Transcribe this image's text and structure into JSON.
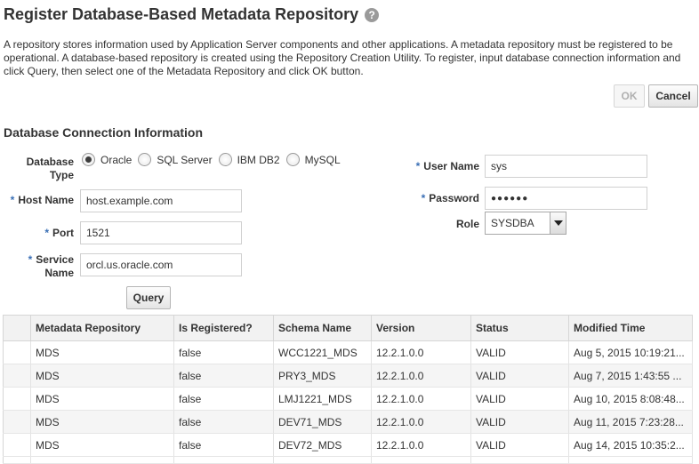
{
  "page": {
    "title": "Register Database-Based Metadata Repository",
    "description": "A repository stores information used by Application Server components and other applications. A metadata repository must be registered to be operational. A database-based repository is created using the Repository Creation Utility. To register, input database connection information and click Query, then select one of the Metadata Repository and click OK button."
  },
  "buttons": {
    "ok": "OK",
    "cancel": "Cancel",
    "query": "Query"
  },
  "section": {
    "title": "Database Connection Information"
  },
  "form": {
    "db_type_label_1": "Database",
    "db_type_label_2": "Type",
    "db_types": [
      "Oracle",
      "SQL Server",
      "IBM DB2",
      "MySQL"
    ],
    "db_type_selected": "Oracle",
    "required_mark": "*",
    "host_label": "Host Name",
    "host_value": "host.example.com",
    "port_label": "Port",
    "port_value": "1521",
    "service_label_1": "Service",
    "service_label_2": "Name",
    "service_value": "orcl.us.oracle.com",
    "user_label": "User Name",
    "user_value": "sys",
    "password_label": "Password",
    "password_value": "●●●●●●",
    "role_label": "Role",
    "role_value": "SYSDBA"
  },
  "table": {
    "columns": [
      "Metadata Repository",
      "Is Registered?",
      "Schema Name",
      "Version",
      "Status",
      "Modified Time"
    ],
    "rows": [
      [
        "MDS",
        "false",
        "WCC1221_MDS",
        "12.2.1.0.0",
        "VALID",
        "Aug 5, 2015 10:19:21..."
      ],
      [
        "MDS",
        "false",
        "PRY3_MDS",
        "12.2.1.0.0",
        "VALID",
        "Aug 7, 2015 1:43:55 ..."
      ],
      [
        "MDS",
        "false",
        "LMJ1221_MDS",
        "12.2.1.0.0",
        "VALID",
        "Aug 10, 2015 8:08:48..."
      ],
      [
        "MDS",
        "false",
        "DEV71_MDS",
        "12.2.1.0.0",
        "VALID",
        "Aug 11, 2015 7:23:28..."
      ],
      [
        "MDS",
        "false",
        "DEV72_MDS",
        "12.2.1.0.0",
        "VALID",
        "Aug 14, 2015 10:35:2..."
      ]
    ]
  }
}
